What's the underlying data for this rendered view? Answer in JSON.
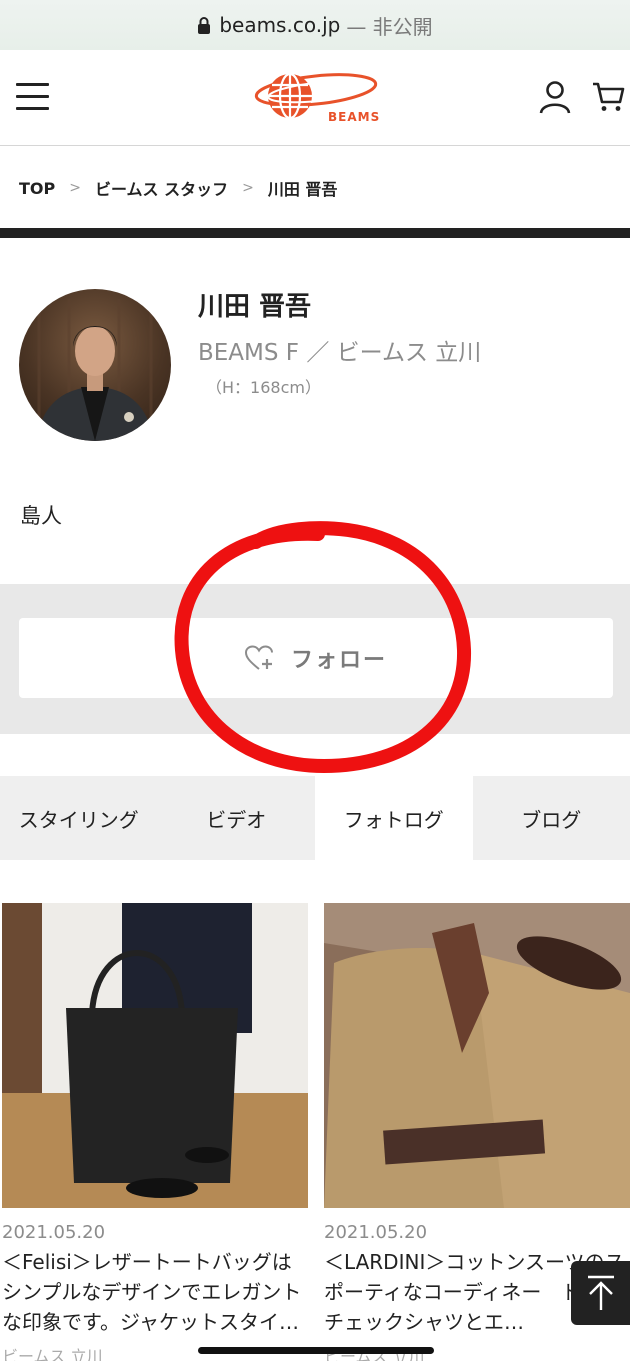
{
  "urlbar": {
    "domain": "beams.co.jp",
    "status": "— 非公開"
  },
  "header": {
    "logo_text": "BEAMS"
  },
  "breadcrumb": {
    "items": [
      "TOP",
      "ビームス スタッフ",
      "川田 晋吾"
    ],
    "separator": ">"
  },
  "profile": {
    "name": "川田 晋吾",
    "shop": "BEAMS F ／ ビームス 立川",
    "height": "（H：168cm）",
    "bio": "島人"
  },
  "follow": {
    "label": "フォロー"
  },
  "tabs": [
    {
      "label": "スタイリング",
      "active": false
    },
    {
      "label": "ビデオ",
      "active": false
    },
    {
      "label": "フォトログ",
      "active": true
    },
    {
      "label": "ブログ",
      "active": false
    }
  ],
  "cards": [
    {
      "date": "2021.05.20",
      "title": "＜Felisi＞レザートートバッグはシンプルなデザインでエレガントな印象です。ジャケットスタイ…",
      "shop": "ビームス 立川"
    },
    {
      "date": "2021.05.20",
      "title": "＜LARDINI＞コットンスーツのスポーティなコーディネー　ドラスチェックシャツとエ…",
      "shop": "ビームス 立川"
    }
  ],
  "colors": {
    "brand": "#e8522a",
    "annotation": "#ee1111",
    "dark": "#222222"
  }
}
